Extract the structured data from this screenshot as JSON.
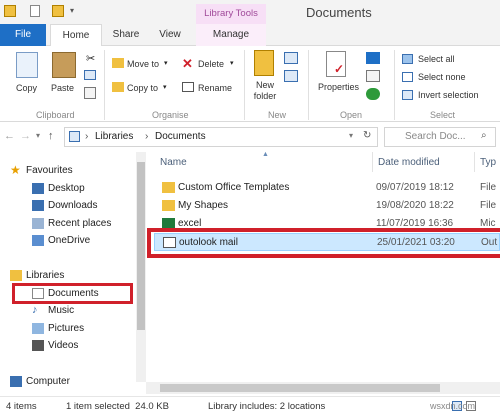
{
  "window": {
    "title": "Documents",
    "context_tab": "Library Tools"
  },
  "tabs": {
    "file": "File",
    "home": "Home",
    "share": "Share",
    "view": "View",
    "manage": "Manage"
  },
  "ribbon": {
    "copy": "Copy",
    "paste": "Paste",
    "move_to": "Move to",
    "copy_to": "Copy to",
    "delete": "Delete",
    "rename": "Rename",
    "new_folder": "New folder",
    "properties": "Properties",
    "select_all": "Select all",
    "select_none": "Select none",
    "invert_selection": "Invert selection",
    "groups": {
      "clipboard": "Clipboard",
      "organise": "Organise",
      "new": "New",
      "open": "Open",
      "select": "Select"
    }
  },
  "address": {
    "crumbs": [
      "Libraries",
      "Documents"
    ],
    "search_placeholder": "Search Doc..."
  },
  "nav": {
    "favourites": "Favourites",
    "fav_items": [
      "Desktop",
      "Downloads",
      "Recent places",
      "OneDrive"
    ],
    "libraries": "Libraries",
    "lib_items": [
      "Documents",
      "Music",
      "Pictures",
      "Videos"
    ],
    "computer": "Computer"
  },
  "columns": {
    "name": "Name",
    "date": "Date modified",
    "type": "Typ"
  },
  "files": [
    {
      "name": "Custom Office Templates",
      "date": "09/07/2019 18:12",
      "type": "File",
      "icon": "folder-icon"
    },
    {
      "name": "My Shapes",
      "date": "19/08/2020 18:22",
      "type": "File",
      "icon": "folder-icon"
    },
    {
      "name": "excel",
      "date": "11/07/2019 16:36",
      "type": "Mic",
      "icon": "excel-icon"
    },
    {
      "name": "outolook mail",
      "date": "25/01/2021 03:20",
      "type": "Out",
      "icon": "mail-icon"
    }
  ],
  "status": {
    "items": "4 items",
    "selected": "1 item selected  24.0 KB",
    "library": "Library includes: 2 locations"
  },
  "watermark": "wsxdn.com",
  "colors": {
    "accent": "#1e6fc6",
    "highlight_red": "#d0202a",
    "selection": "#cce8ff"
  }
}
